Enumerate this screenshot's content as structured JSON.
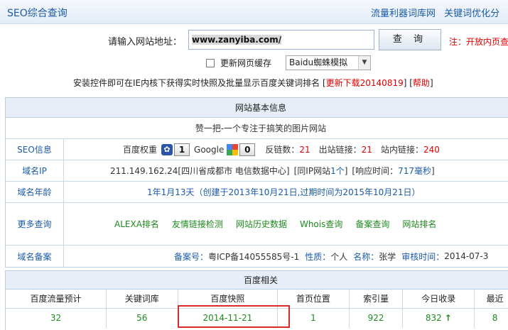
{
  "header": {
    "title": "SEO综合查询",
    "links": [
      "流量利器词库网",
      "关键词优化分"
    ]
  },
  "search": {
    "label": "请输入网站地址：",
    "value": "www.zanyiba.com/",
    "button": "查 询",
    "note": "注：开放内页查"
  },
  "options": {
    "refresh_label": "更新网页缓存",
    "engine_selected": "Baidu蜘蛛模拟"
  },
  "install": {
    "text": "安装控件即可在IE内核下获得实时快照及批量显示百度关键词排名",
    "download": "更新下载20140819",
    "help": "帮助"
  },
  "site_info": {
    "header": "网站基本信息",
    "site_title": "赞一把-一个专注于搞笑的图片网站",
    "seo": {
      "label": "SEO信息",
      "baidu_weight_label": "百度权重",
      "baidu_weight": "1",
      "google_label": "Google",
      "google_rank": "0",
      "backlinks_label": "反链数：",
      "backlinks": "21",
      "outbound_label": "出站链接：",
      "outbound": "21",
      "internal_label": "站内链接：",
      "internal": "240"
    },
    "ip": {
      "label": "域名IP",
      "address": "211.149.162.24[四川省成都市 电信数据中心]",
      "same_ip_open": "[同IP网站",
      "same_ip": "1个",
      "same_ip_close": "]",
      "response_open": "[响应时间：",
      "response": "717毫秒",
      "response_close": "]"
    },
    "age": {
      "label": "域名年龄",
      "value": "1年1月13天（创建于2013年10月21日,过期时间为2015年10月21日）"
    },
    "more": {
      "label": "更多查询",
      "links": [
        "ALEXA排名",
        "友情链接检测",
        "网站历史数据",
        "Whois查询",
        "备案查询",
        "网站排名"
      ]
    },
    "icp": {
      "label": "域名备案",
      "no_label": "备案号：",
      "no": "粤ICP备14055585号-1",
      "type_label": "性质：",
      "type": "个人",
      "name_label": "名称：",
      "name": "张学",
      "time_label": "审核时间：",
      "time": "2014-07-3"
    }
  },
  "baidu": {
    "header": "百度相关",
    "columns": [
      "百度流量预计",
      "关键词库",
      "百度快照",
      "首页位置",
      "索引量",
      "今日收录",
      "最近"
    ],
    "values": [
      "32",
      "56",
      "2014-11-21",
      "1",
      "922",
      "832",
      "8"
    ],
    "up_arrow": "↑"
  }
}
